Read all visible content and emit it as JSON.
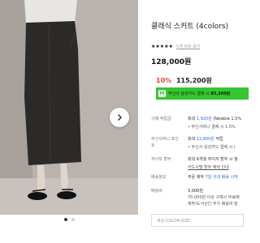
{
  "product": {
    "title": "클래식 스커트 (4colors)",
    "stars": "★★★★★",
    "review_link": "5개 리뷰 보기",
    "price": "128,000원",
    "discount_pct": "10%",
    "sale_price": "115,200원",
    "coupon_text": "무신사 삼성카드 결제 시",
    "coupon_amount": "85,200원"
  },
  "details": {
    "purchase_points_label": "구매 적립금",
    "purchase_points_line1_prefix": "최대",
    "purchase_points_line1_amount": "1,920원",
    "purchase_points_line1_suffix": "(Newbie 1.5%",
    "purchase_points_line2": "• 무신사머니 결제 시 1.5%",
    "musinsa_points_label": "무신사머니 포인트",
    "musinsa_points_line1_prefix": "최대",
    "musinsa_points_line1_amount": "12,800원",
    "musinsa_points_line1_suffix": "적립",
    "musinsa_points_line2": "• 무신사 삼성카드 결제 시 (",
    "installment_label": "무이자 할부",
    "installment_line1": "최대 6개월 무이자 할부 시 월",
    "installment_line2": "카드사별 할부 혜택 안내",
    "delivery_label": "배송정보",
    "delivery_prefix": "주문 제작",
    "delivery_highlight": "7일 이내 배송 시작",
    "shipping_label": "배송비",
    "shipping_line1": "3,000원",
    "shipping_line2": "70,000원 이상 구매시 무료배",
    "shipping_line3": "제주/도서산간 추가 배송비 발"
  },
  "options": {
    "color_size_placeholder": "색상:COLOR-SIZE"
  },
  "colors": {
    "sale_red": "#e8472f",
    "coupon_green": "#35c72f",
    "link_blue": "#2a6de0"
  },
  "gallery": {
    "next_icon": "chevron-right-icon",
    "page_indicator_active": 1,
    "page_indicator_count": 2
  }
}
